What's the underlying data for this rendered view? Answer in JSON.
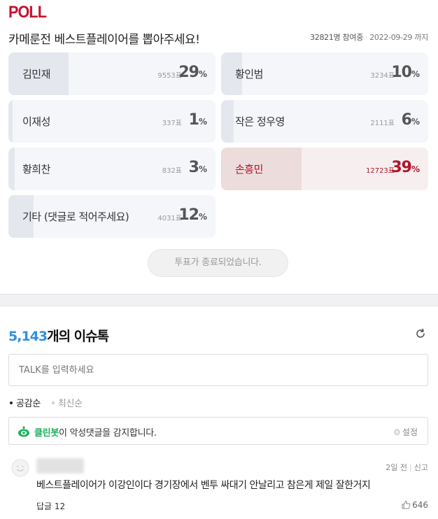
{
  "poll": {
    "heading": "POLL",
    "question": "카메룬전 베스트플레이어를 뽑아주세요!",
    "participants": "32821명 참여중",
    "deadline": "2022-09-29 까지",
    "options": [
      {
        "name": "김민재",
        "votes": "9553표",
        "percent": "29",
        "share": 0.29,
        "winner": false
      },
      {
        "name": "황인범",
        "votes": "3234표",
        "percent": "10",
        "share": 0.1,
        "winner": false
      },
      {
        "name": "이재성",
        "votes": "337표",
        "percent": "1",
        "share": 0.01,
        "winner": false
      },
      {
        "name": "작은 정우영",
        "votes": "2111표",
        "percent": "6",
        "share": 0.06,
        "winner": false
      },
      {
        "name": "황희찬",
        "votes": "832표",
        "percent": "3",
        "share": 0.03,
        "winner": false
      },
      {
        "name": "손흥민",
        "votes": "12723표",
        "percent": "39",
        "share": 0.39,
        "winner": true
      },
      {
        "name": "기타 (댓글로 적어주세요)",
        "votes": "4031표",
        "percent": "12",
        "share": 0.12,
        "winner": false
      }
    ],
    "percent_sign": "%",
    "ended_label": "투표가 종료되었습니다."
  },
  "talk": {
    "count": "5,143",
    "title_suffix": "개의 이슈톡",
    "input_placeholder": "TALK를 입력하세요",
    "sort_tabs": [
      {
        "label": "공감순",
        "active": true
      },
      {
        "label": "최신순",
        "active": false
      }
    ],
    "cleanbot": {
      "brand": "클린봇",
      "message": "이 악성댓글을 감지합니다.",
      "settings_label": "설정"
    },
    "comments": [
      {
        "time": "2일 전",
        "report_label": "신고",
        "body": "베스트플레이어가 이강인이다 경기장에서 벤투 싸대기 안날리고 참은게 제일 잘한거지",
        "replies": "답글 12",
        "likes": "646"
      }
    ]
  },
  "colors": {
    "brand_red": "#c8102e",
    "winner_red": "#b2132b",
    "count_blue": "#2f8fe3",
    "cleanbot_green": "#19b35a"
  },
  "icons": [
    "refresh-icon",
    "cleanbot-eye-icon",
    "gear-icon",
    "avatar-smiley-icon",
    "thumbs-up-icon"
  ]
}
